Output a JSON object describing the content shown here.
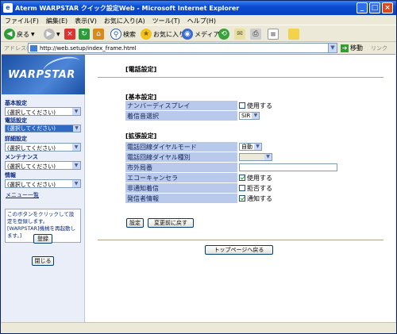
{
  "window": {
    "title": "Aterm WARPSTAR クイック設定Web - Microsoft Internet Explorer"
  },
  "menubar": [
    "ファイル(F)",
    "編集(E)",
    "表示(V)",
    "お気に入り(A)",
    "ツール(T)",
    "ヘルプ(H)"
  ],
  "toolbar": {
    "back": "戻る",
    "search": "検索",
    "favorites": "お気に入り",
    "media": "メディア"
  },
  "address": {
    "label": "アドレス(D)",
    "url": "http://web.setup/index_frame.html",
    "go": "移動",
    "links": "リンク"
  },
  "sidebar": {
    "logo": "WARPSTAR",
    "sections": [
      {
        "label": "基本設定",
        "value": "(選択してください)"
      },
      {
        "label": "電話設定",
        "value": "(選択してください)"
      },
      {
        "label": "詳細設定",
        "value": "(選択してください)"
      },
      {
        "label": "メンテナンス",
        "value": "(選択してください)"
      },
      {
        "label": "情報",
        "value": "(選択してください)"
      }
    ],
    "menu_list": "メニュー一覧",
    "note": "このボタンをクリックして設定を登録します。[WARPSTAR]機械を再起動します。]",
    "register_button": "登録",
    "close_button": "閉じる"
  },
  "main": {
    "page_title": "[電話設定]",
    "basic": {
      "heading": "[基本設定]",
      "rows": [
        {
          "key": "ナンバーディスプレイ",
          "value": "使用する"
        },
        {
          "key": "着信音選択",
          "value": "SIR"
        }
      ]
    },
    "extended": {
      "heading": "[拡張設定]",
      "rows": [
        {
          "key": "電話回線ダイヤルモード",
          "value": "自動"
        },
        {
          "key": "電話回線ダイヤル種別",
          "value": ""
        },
        {
          "key": "市外局番",
          "value": ""
        },
        {
          "key": "エコーキャンセラ",
          "value": "使用する"
        },
        {
          "key": "非通知着信",
          "value": "拒否する"
        },
        {
          "key": "発信者情報",
          "value": "通知する"
        }
      ]
    },
    "set_button": "設定",
    "revert_button": "変更前に戻す",
    "top_button": "トップページへ戻る"
  }
}
